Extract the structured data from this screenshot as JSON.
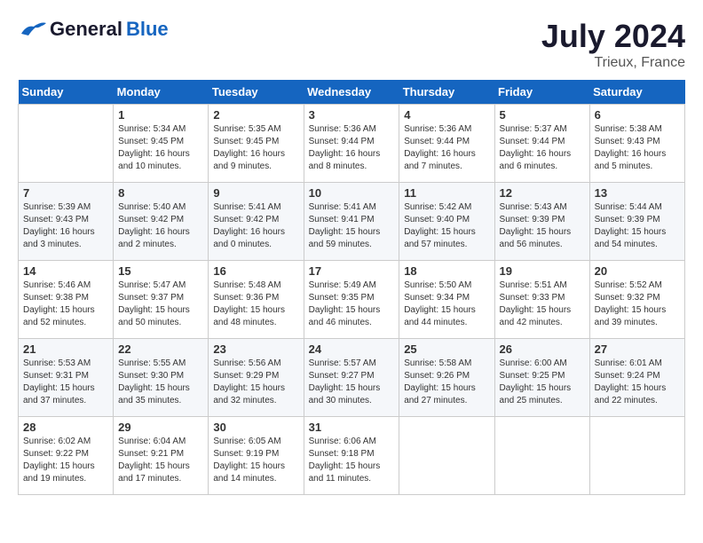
{
  "header": {
    "logo_general": "General",
    "logo_blue": "Blue",
    "month_year": "July 2024",
    "location": "Trieux, France"
  },
  "weekdays": [
    "Sunday",
    "Monday",
    "Tuesday",
    "Wednesday",
    "Thursday",
    "Friday",
    "Saturday"
  ],
  "weeks": [
    [
      {
        "day": "",
        "sunrise": "",
        "sunset": "",
        "daylight": ""
      },
      {
        "day": "1",
        "sunrise": "Sunrise: 5:34 AM",
        "sunset": "Sunset: 9:45 PM",
        "daylight": "Daylight: 16 hours and 10 minutes."
      },
      {
        "day": "2",
        "sunrise": "Sunrise: 5:35 AM",
        "sunset": "Sunset: 9:45 PM",
        "daylight": "Daylight: 16 hours and 9 minutes."
      },
      {
        "day": "3",
        "sunrise": "Sunrise: 5:36 AM",
        "sunset": "Sunset: 9:44 PM",
        "daylight": "Daylight: 16 hours and 8 minutes."
      },
      {
        "day": "4",
        "sunrise": "Sunrise: 5:36 AM",
        "sunset": "Sunset: 9:44 PM",
        "daylight": "Daylight: 16 hours and 7 minutes."
      },
      {
        "day": "5",
        "sunrise": "Sunrise: 5:37 AM",
        "sunset": "Sunset: 9:44 PM",
        "daylight": "Daylight: 16 hours and 6 minutes."
      },
      {
        "day": "6",
        "sunrise": "Sunrise: 5:38 AM",
        "sunset": "Sunset: 9:43 PM",
        "daylight": "Daylight: 16 hours and 5 minutes."
      }
    ],
    [
      {
        "day": "7",
        "sunrise": "Sunrise: 5:39 AM",
        "sunset": "Sunset: 9:43 PM",
        "daylight": "Daylight: 16 hours and 3 minutes."
      },
      {
        "day": "8",
        "sunrise": "Sunrise: 5:40 AM",
        "sunset": "Sunset: 9:42 PM",
        "daylight": "Daylight: 16 hours and 2 minutes."
      },
      {
        "day": "9",
        "sunrise": "Sunrise: 5:41 AM",
        "sunset": "Sunset: 9:42 PM",
        "daylight": "Daylight: 16 hours and 0 minutes."
      },
      {
        "day": "10",
        "sunrise": "Sunrise: 5:41 AM",
        "sunset": "Sunset: 9:41 PM",
        "daylight": "Daylight: 15 hours and 59 minutes."
      },
      {
        "day": "11",
        "sunrise": "Sunrise: 5:42 AM",
        "sunset": "Sunset: 9:40 PM",
        "daylight": "Daylight: 15 hours and 57 minutes."
      },
      {
        "day": "12",
        "sunrise": "Sunrise: 5:43 AM",
        "sunset": "Sunset: 9:39 PM",
        "daylight": "Daylight: 15 hours and 56 minutes."
      },
      {
        "day": "13",
        "sunrise": "Sunrise: 5:44 AM",
        "sunset": "Sunset: 9:39 PM",
        "daylight": "Daylight: 15 hours and 54 minutes."
      }
    ],
    [
      {
        "day": "14",
        "sunrise": "Sunrise: 5:46 AM",
        "sunset": "Sunset: 9:38 PM",
        "daylight": "Daylight: 15 hours and 52 minutes."
      },
      {
        "day": "15",
        "sunrise": "Sunrise: 5:47 AM",
        "sunset": "Sunset: 9:37 PM",
        "daylight": "Daylight: 15 hours and 50 minutes."
      },
      {
        "day": "16",
        "sunrise": "Sunrise: 5:48 AM",
        "sunset": "Sunset: 9:36 PM",
        "daylight": "Daylight: 15 hours and 48 minutes."
      },
      {
        "day": "17",
        "sunrise": "Sunrise: 5:49 AM",
        "sunset": "Sunset: 9:35 PM",
        "daylight": "Daylight: 15 hours and 46 minutes."
      },
      {
        "day": "18",
        "sunrise": "Sunrise: 5:50 AM",
        "sunset": "Sunset: 9:34 PM",
        "daylight": "Daylight: 15 hours and 44 minutes."
      },
      {
        "day": "19",
        "sunrise": "Sunrise: 5:51 AM",
        "sunset": "Sunset: 9:33 PM",
        "daylight": "Daylight: 15 hours and 42 minutes."
      },
      {
        "day": "20",
        "sunrise": "Sunrise: 5:52 AM",
        "sunset": "Sunset: 9:32 PM",
        "daylight": "Daylight: 15 hours and 39 minutes."
      }
    ],
    [
      {
        "day": "21",
        "sunrise": "Sunrise: 5:53 AM",
        "sunset": "Sunset: 9:31 PM",
        "daylight": "Daylight: 15 hours and 37 minutes."
      },
      {
        "day": "22",
        "sunrise": "Sunrise: 5:55 AM",
        "sunset": "Sunset: 9:30 PM",
        "daylight": "Daylight: 15 hours and 35 minutes."
      },
      {
        "day": "23",
        "sunrise": "Sunrise: 5:56 AM",
        "sunset": "Sunset: 9:29 PM",
        "daylight": "Daylight: 15 hours and 32 minutes."
      },
      {
        "day": "24",
        "sunrise": "Sunrise: 5:57 AM",
        "sunset": "Sunset: 9:27 PM",
        "daylight": "Daylight: 15 hours and 30 minutes."
      },
      {
        "day": "25",
        "sunrise": "Sunrise: 5:58 AM",
        "sunset": "Sunset: 9:26 PM",
        "daylight": "Daylight: 15 hours and 27 minutes."
      },
      {
        "day": "26",
        "sunrise": "Sunrise: 6:00 AM",
        "sunset": "Sunset: 9:25 PM",
        "daylight": "Daylight: 15 hours and 25 minutes."
      },
      {
        "day": "27",
        "sunrise": "Sunrise: 6:01 AM",
        "sunset": "Sunset: 9:24 PM",
        "daylight": "Daylight: 15 hours and 22 minutes."
      }
    ],
    [
      {
        "day": "28",
        "sunrise": "Sunrise: 6:02 AM",
        "sunset": "Sunset: 9:22 PM",
        "daylight": "Daylight: 15 hours and 19 minutes."
      },
      {
        "day": "29",
        "sunrise": "Sunrise: 6:04 AM",
        "sunset": "Sunset: 9:21 PM",
        "daylight": "Daylight: 15 hours and 17 minutes."
      },
      {
        "day": "30",
        "sunrise": "Sunrise: 6:05 AM",
        "sunset": "Sunset: 9:19 PM",
        "daylight": "Daylight: 15 hours and 14 minutes."
      },
      {
        "day": "31",
        "sunrise": "Sunrise: 6:06 AM",
        "sunset": "Sunset: 9:18 PM",
        "daylight": "Daylight: 15 hours and 11 minutes."
      },
      {
        "day": "",
        "sunrise": "",
        "sunset": "",
        "daylight": ""
      },
      {
        "day": "",
        "sunrise": "",
        "sunset": "",
        "daylight": ""
      },
      {
        "day": "",
        "sunrise": "",
        "sunset": "",
        "daylight": ""
      }
    ]
  ]
}
